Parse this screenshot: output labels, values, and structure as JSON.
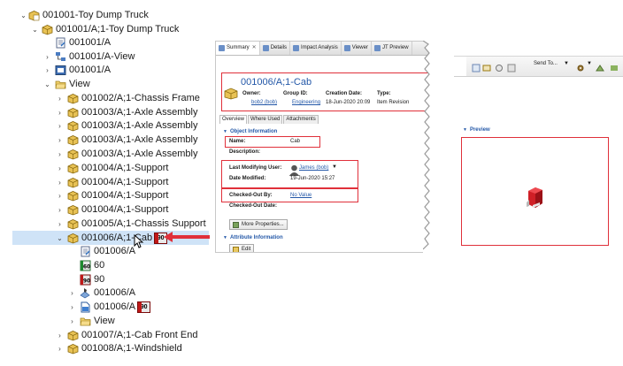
{
  "tree": {
    "rows": [
      {
        "label": "001001-Toy Dump Truck",
        "icon": "item-icon"
      },
      {
        "label": "001001/A;1-Toy Dump Truck",
        "icon": "revision-icon"
      },
      {
        "label": "001001/A",
        "icon": "form-icon"
      },
      {
        "label": "001001/A-View",
        "icon": "bom-view-icon"
      },
      {
        "label": "001001/A",
        "icon": "drawing-icon"
      },
      {
        "label": "View",
        "icon": "folder-icon"
      },
      {
        "label": "001002/A;1-Chassis Frame",
        "icon": "revision-icon"
      },
      {
        "label": "001003/A;1-Axle Assembly",
        "icon": "revision-icon"
      },
      {
        "label": "001003/A;1-Axle Assembly",
        "icon": "revision-icon"
      },
      {
        "label": "001003/A;1-Axle Assembly",
        "icon": "revision-icon"
      },
      {
        "label": "001003/A;1-Axle Assembly",
        "icon": "revision-icon"
      },
      {
        "label": "001004/A;1-Support",
        "icon": "revision-icon"
      },
      {
        "label": "001004/A;1-Support",
        "icon": "revision-icon"
      },
      {
        "label": "001004/A;1-Support",
        "icon": "revision-icon"
      },
      {
        "label": "001004/A;1-Support",
        "icon": "revision-icon"
      },
      {
        "label": "001005/A;1-Chassis Support",
        "icon": "revision-icon"
      },
      {
        "label": "001006/A;1-Cab",
        "icon": "revision-icon",
        "badge": "90"
      },
      {
        "label": "001006/A",
        "icon": "form-icon"
      },
      {
        "label": "60",
        "icon": "status-60-icon"
      },
      {
        "label": "90",
        "icon": "status-90-icon"
      },
      {
        "label": "001006/A",
        "icon": "model-icon"
      },
      {
        "label": "001006/A",
        "icon": "document-icon",
        "badge": "90"
      },
      {
        "label": "View",
        "icon": "folder-icon"
      },
      {
        "label": "001007/A;1-Cab Front End",
        "icon": "revision-icon"
      },
      {
        "label": "001008/A;1-Windshield",
        "icon": "revision-icon"
      }
    ]
  },
  "summary": {
    "tabs": [
      "Summary",
      "Details",
      "Impact Analysis",
      "Viewer",
      "JT Preview"
    ],
    "title": "001006/A;1-Cab",
    "owner_label": "Owner:",
    "owner_value": "bob2 (bob)",
    "group_label": "Group ID:",
    "group_value": "Engineering",
    "created_label": "Creation Date:",
    "created_value": "18-Jun-2020 20:09",
    "type_label": "Type:",
    "type_value": "Item Revision",
    "subtabs": [
      "Overview",
      "Where Used",
      "Attachments"
    ],
    "section_object": "Object Information",
    "name_label": "Name:",
    "name_value": "Cab",
    "desc_label": "Description:",
    "lmu_label": "Last Modifying User:",
    "lmu_value": "James (bob)",
    "date_mod_label": "Date Modified:",
    "date_mod_value": "19-Jun-2020 15:27",
    "checked_out_by_label": "Checked-Out By:",
    "checked_out_by_value": "No Value",
    "checked_out_date_label": "Checked-Out Date:",
    "more_props": "More Properties...",
    "section_attr": "Attribute Information",
    "edit": "Edit"
  },
  "preview": {
    "send_to": "Send To...",
    "label": "Preview"
  },
  "colors": {
    "highlight": "#e0303a",
    "link": "#2458a8",
    "selection": "#cfe3f7"
  }
}
